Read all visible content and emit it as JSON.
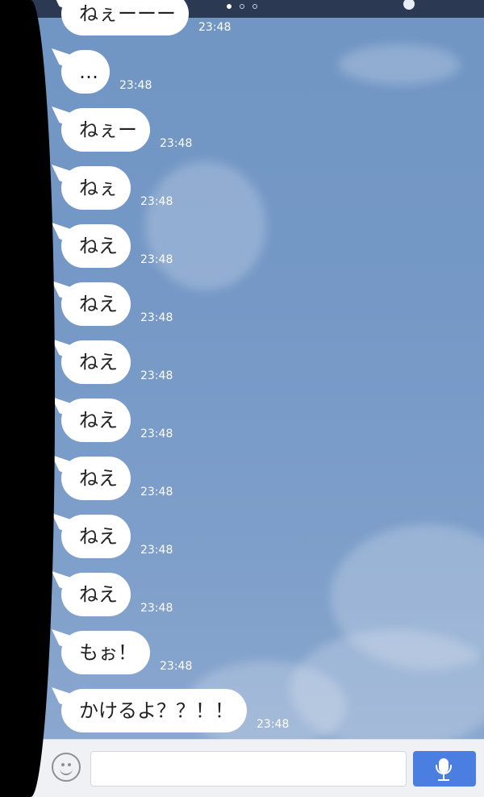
{
  "messages": [
    {
      "text": "ねぇーーー",
      "time": "23:48"
    },
    {
      "text": "…",
      "time": "23:48"
    },
    {
      "text": "ねぇー",
      "time": "23:48"
    },
    {
      "text": "ねぇ",
      "time": "23:48"
    },
    {
      "text": "ねえ",
      "time": "23:48"
    },
    {
      "text": "ねえ",
      "time": "23:48"
    },
    {
      "text": "ねえ",
      "time": "23:48"
    },
    {
      "text": "ねえ",
      "time": "23:48"
    },
    {
      "text": "ねえ",
      "time": "23:48"
    },
    {
      "text": "ねえ",
      "time": "23:48"
    },
    {
      "text": "ねえ",
      "time": "23:48"
    },
    {
      "text": "もぉ！",
      "time": "23:48"
    },
    {
      "text": "かけるよ？？！！",
      "time": "23:48"
    }
  ],
  "input": {
    "value": "",
    "placeholder": ""
  },
  "icons": {
    "emoji": "smiley-icon",
    "send": "microphone-icon",
    "more": "plus-icon"
  },
  "colors": {
    "chat_background": "#7498c6",
    "bubble": "#ffffff",
    "send_button": "#4a7ee0"
  }
}
